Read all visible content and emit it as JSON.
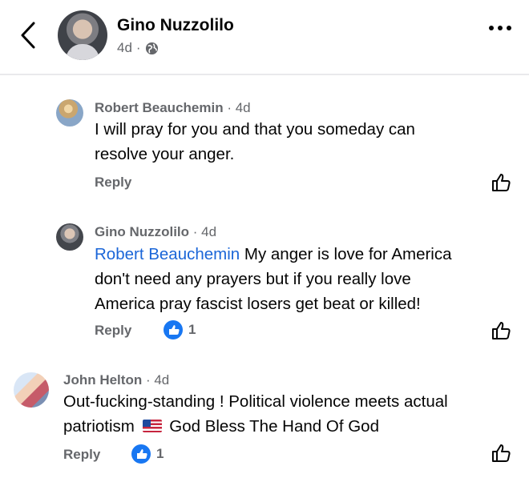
{
  "header": {
    "name": "Gino Nuzzolilo",
    "time": "4d",
    "separator": "·"
  },
  "comments": [
    {
      "author": "Robert Beauchemin",
      "time": "· 4d",
      "line1": "I will pray for you and that you someday can",
      "line2": "resolve your anger.",
      "reply_label": "Reply"
    },
    {
      "author": "Gino Nuzzolilo",
      "time": "· 4d",
      "mention": "Robert Beauchemin",
      "line1_rest": " My anger is love for America",
      "line2": "don't need any prayers but if you really love",
      "line3": "America pray fascist losers get beat or killed!",
      "reply_label": "Reply",
      "like_count": "1"
    },
    {
      "author": "John Helton",
      "time": "· 4d",
      "line1": "Out-fucking-standing ! Political violence meets actual",
      "line2_a": "patriotism",
      "line2_b": "God Bless The Hand Of God",
      "reply_label": "Reply",
      "like_count": "1"
    }
  ],
  "icons": {
    "back": "chevron-left-icon",
    "audience": "globe-icon",
    "more": "more-dots-icon",
    "like_outline": "thumbs-up-outline-icon",
    "like_reaction": "thumbs-up-filled-icon",
    "flag": "us-flag-emoji"
  },
  "colors": {
    "link": "#1b66d8",
    "like_blue": "#1877f2",
    "secondary_text": "#65676b"
  }
}
